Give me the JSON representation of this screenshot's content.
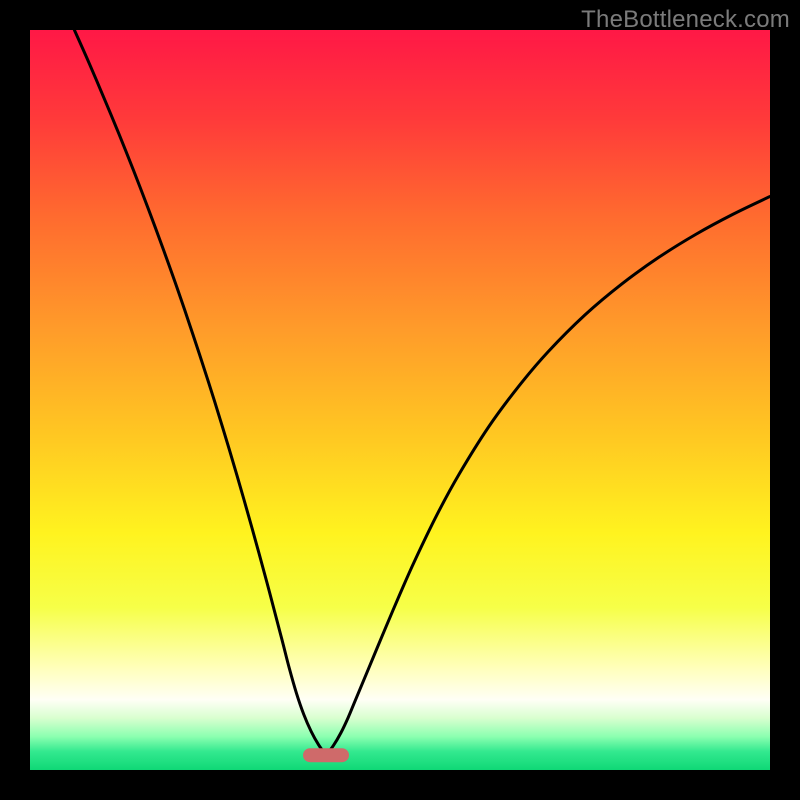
{
  "watermark": "TheBottleneck.com",
  "colors": {
    "frame": "#000000",
    "curve": "#000000",
    "marker": "#cf6a6a",
    "gradient_stops": [
      {
        "offset": 0.0,
        "color": "#ff1846"
      },
      {
        "offset": 0.12,
        "color": "#ff3a3a"
      },
      {
        "offset": 0.25,
        "color": "#ff6a2f"
      },
      {
        "offset": 0.4,
        "color": "#ff9a2a"
      },
      {
        "offset": 0.55,
        "color": "#ffc822"
      },
      {
        "offset": 0.68,
        "color": "#fff31f"
      },
      {
        "offset": 0.78,
        "color": "#f6ff48"
      },
      {
        "offset": 0.86,
        "color": "#ffffb8"
      },
      {
        "offset": 0.905,
        "color": "#fffff6"
      },
      {
        "offset": 0.93,
        "color": "#d8ffcf"
      },
      {
        "offset": 0.955,
        "color": "#8bffb0"
      },
      {
        "offset": 0.975,
        "color": "#33e98f"
      },
      {
        "offset": 1.0,
        "color": "#0fd876"
      }
    ]
  },
  "chart_data": {
    "type": "line",
    "title": "",
    "xlabel": "",
    "ylabel": "",
    "xlim": [
      0,
      100
    ],
    "ylim": [
      0,
      100
    ],
    "marker": {
      "x": 40,
      "y": 2
    },
    "series": [
      {
        "name": "left-curve",
        "x": [
          6,
          8,
          10,
          12,
          14,
          16,
          18,
          20,
          22,
          24,
          26,
          28,
          30,
          32,
          34,
          35,
          36,
          37,
          38,
          39,
          40
        ],
        "y": [
          100,
          95.5,
          90.8,
          86.0,
          81.0,
          75.8,
          70.4,
          64.8,
          58.9,
          52.8,
          46.4,
          39.7,
          32.7,
          25.4,
          17.8,
          13.9,
          10.4,
          7.5,
          5.2,
          3.4,
          2.0
        ]
      },
      {
        "name": "right-curve",
        "x": [
          40,
          41,
          42,
          43,
          44,
          46,
          48,
          50,
          52,
          55,
          58,
          62,
          66,
          70,
          75,
          80,
          85,
          90,
          95,
          100
        ],
        "y": [
          2.0,
          3.3,
          5.0,
          7.1,
          9.5,
          14.3,
          19.1,
          23.8,
          28.3,
          34.5,
          40.0,
          46.4,
          51.8,
          56.5,
          61.5,
          65.7,
          69.3,
          72.4,
          75.1,
          77.5
        ]
      }
    ]
  }
}
